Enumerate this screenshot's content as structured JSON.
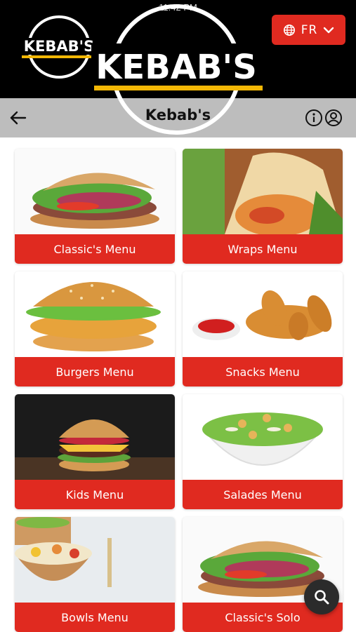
{
  "status": {
    "time": "11:42 PM"
  },
  "brand": {
    "logo_text": "KEBAB'S"
  },
  "language": {
    "code": "FR",
    "icon": "globe-icon"
  },
  "header": {
    "title": "Kebab's"
  },
  "icons": {
    "back": "arrow-left-icon",
    "info": "info-icon",
    "account": "user-icon",
    "search": "search-icon"
  },
  "colors": {
    "accent": "#e02a20",
    "top_bar": "#000000",
    "sub_bar": "#bdbdbd",
    "logo_underline": "#f2b705"
  },
  "menu": [
    {
      "label": "Classic's Menu",
      "image": "kebab sandwich"
    },
    {
      "label": "Wraps Menu",
      "image": "chicken wrap"
    },
    {
      "label": "Burgers Menu",
      "image": "chicken burger"
    },
    {
      "label": "Snacks Menu",
      "image": "chicken tenders with ketchup"
    },
    {
      "label": "Kids Menu",
      "image": "cheeseburger"
    },
    {
      "label": "Salades Menu",
      "image": "caesar salad bowl"
    },
    {
      "label": "Bowls Menu",
      "image": "rice bowl"
    },
    {
      "label": "Classic's Solo",
      "image": "kebab sandwich"
    }
  ]
}
